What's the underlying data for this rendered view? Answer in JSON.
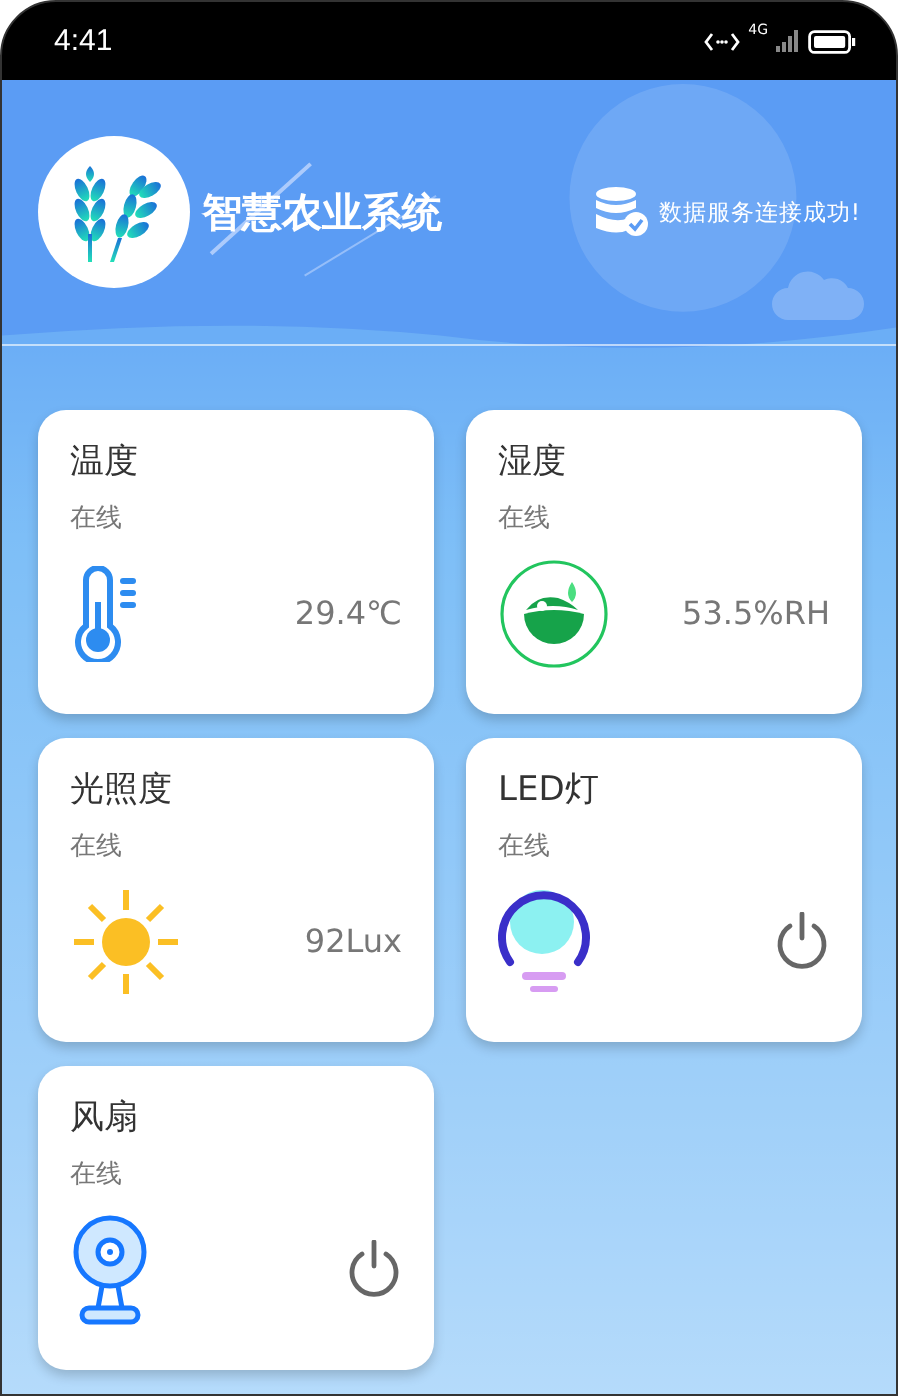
{
  "status_bar": {
    "time": "4:41",
    "network": "4G"
  },
  "header": {
    "title": "智慧农业系统",
    "connection": "数据服务连接成功!"
  },
  "cards": [
    {
      "kind": "sensor",
      "title": "温度",
      "status": "在线",
      "reading": "29.4℃"
    },
    {
      "kind": "sensor",
      "title": "湿度",
      "status": "在线",
      "reading": "53.5%RH"
    },
    {
      "kind": "sensor",
      "title": "光照度",
      "status": "在线",
      "reading": "92Lux"
    },
    {
      "kind": "switch",
      "title": "LED灯",
      "status": "在线"
    },
    {
      "kind": "switch",
      "title": "风扇",
      "status": "在线"
    }
  ]
}
